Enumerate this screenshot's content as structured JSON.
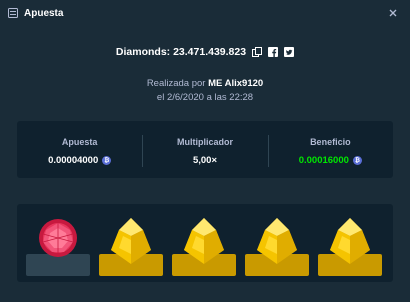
{
  "header": {
    "title": "Apuesta"
  },
  "bet_info": {
    "game_label": "Diamonds: 23.471.439.823",
    "placed_by_prefix": "Realizada por",
    "user": "ME Alix9120",
    "date": "el 2/6/2020 a las 22:28"
  },
  "stats": {
    "bet": {
      "label": "Apuesta",
      "value": "0.00004000"
    },
    "multiplier": {
      "label": "Multiplicador",
      "value": "5,00×"
    },
    "profit": {
      "label": "Beneficio",
      "value": "0.00016000"
    }
  },
  "tiles": [
    {
      "gem": "red-ruby-icon"
    },
    {
      "gem": "yellow-gem-icon"
    },
    {
      "gem": "yellow-gem-icon"
    },
    {
      "gem": "yellow-gem-icon"
    },
    {
      "gem": "yellow-gem-icon"
    }
  ],
  "colors": {
    "background": "#1a2c38",
    "panel": "#0f212e",
    "profit": "#00e701",
    "gold": "#f5c400",
    "ruby": "#e8365d"
  }
}
